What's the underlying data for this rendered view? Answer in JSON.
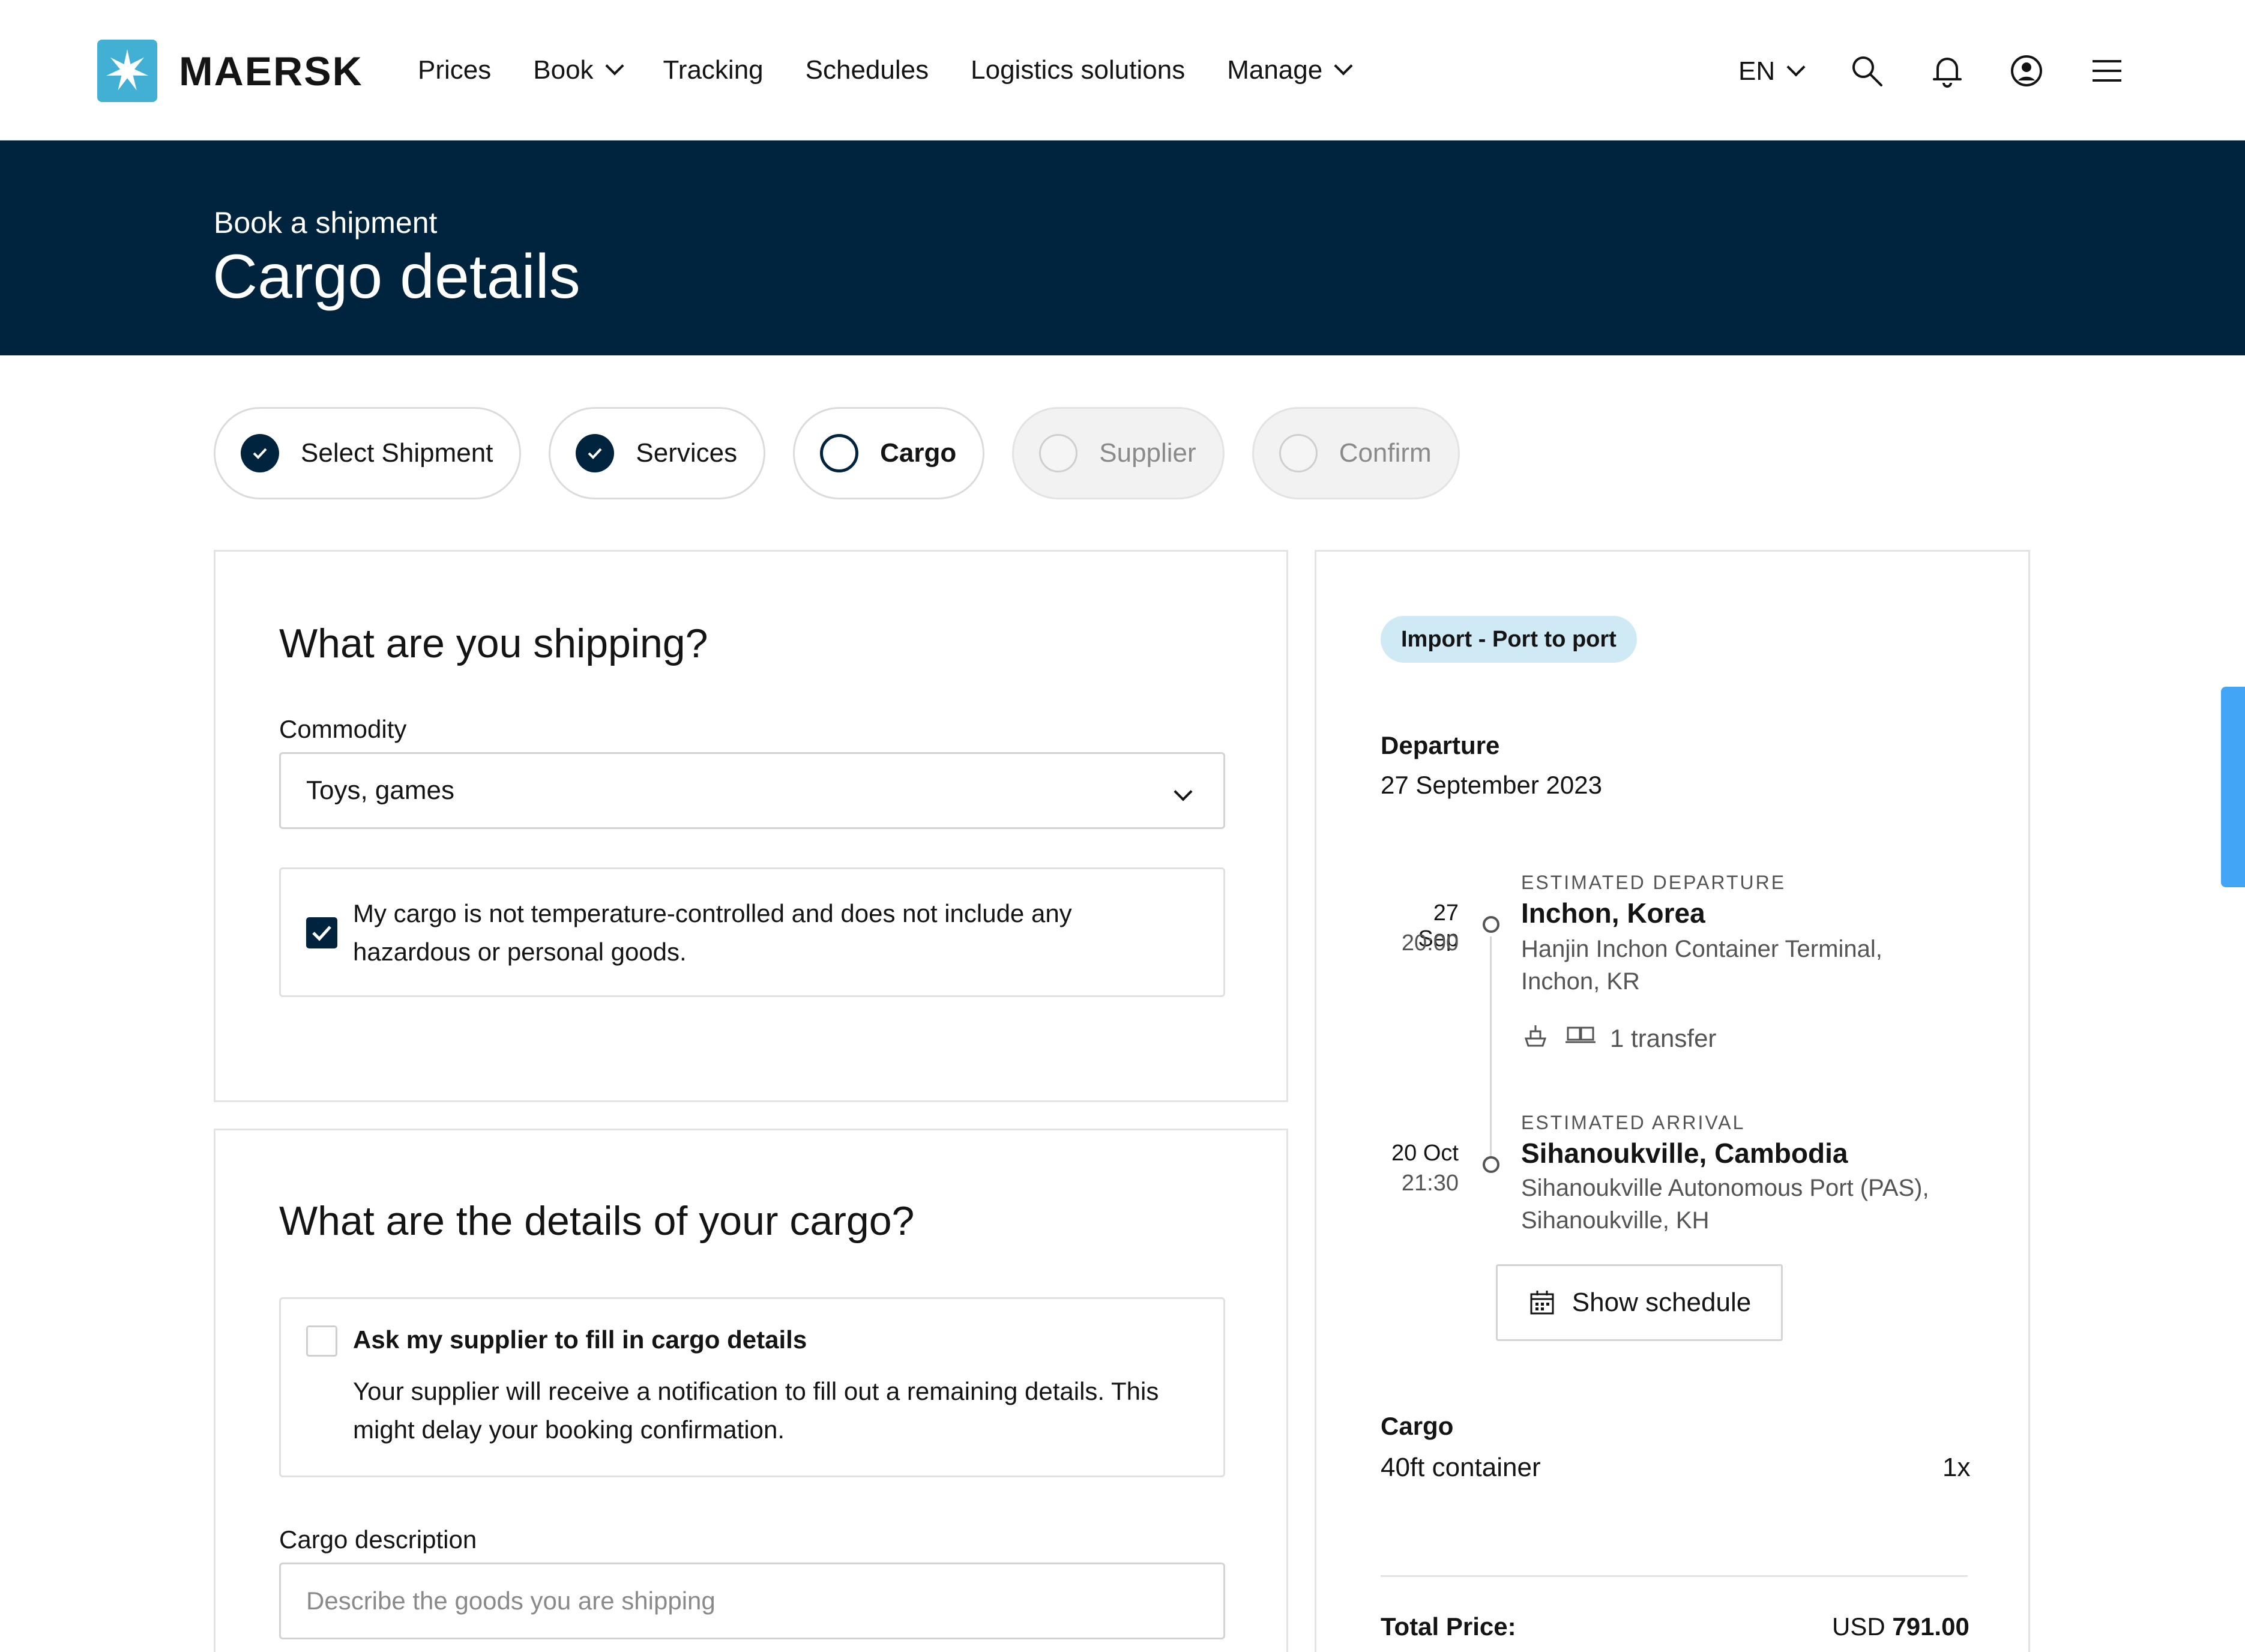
{
  "brand": {
    "name": "MAERSK"
  },
  "nav": {
    "items": [
      {
        "label": "Prices",
        "dropdown": false
      },
      {
        "label": "Book",
        "dropdown": true
      },
      {
        "label": "Tracking",
        "dropdown": false
      },
      {
        "label": "Schedules",
        "dropdown": false
      },
      {
        "label": "Logistics solutions",
        "dropdown": false
      },
      {
        "label": "Manage",
        "dropdown": true
      }
    ],
    "language": "EN",
    "icons": [
      "search-icon",
      "bell-icon",
      "user-icon",
      "menu-icon"
    ]
  },
  "hero": {
    "subtitle": "Book a shipment",
    "title": "Cargo details"
  },
  "steps": [
    {
      "label": "Select Shipment",
      "state": "done"
    },
    {
      "label": "Services",
      "state": "done"
    },
    {
      "label": "Cargo",
      "state": "active"
    },
    {
      "label": "Supplier",
      "state": "todo"
    },
    {
      "label": "Confirm",
      "state": "todo"
    }
  ],
  "shipping_card": {
    "title": "What are you shipping?",
    "commodity_label": "Commodity",
    "commodity_value": "Toys, games",
    "declaration_line1": "My cargo is not temperature-controlled and does not include any",
    "declaration_line2": "hazardous or personal goods.",
    "declaration_checked": true
  },
  "cargo_card": {
    "title": "What are the details of your cargo?",
    "supplier_option_title": "Ask my supplier to fill in cargo details",
    "supplier_option_line1": "Your supplier will receive a notification to fill out a remaining details. This",
    "supplier_option_line2": "might delay your booking confirmation.",
    "supplier_option_checked": false,
    "description_label": "Cargo description",
    "description_placeholder": "Describe the goods you are shipping"
  },
  "summary": {
    "badge": "Import - Port to port",
    "departure_heading": "Departure",
    "departure_date": "27 September 2023",
    "origin": {
      "eyebrow": "ESTIMATED DEPARTURE",
      "date": "27 Sep",
      "time": "20:00",
      "port": "Inchon, Korea",
      "terminal_line1": "Hanjin Inchon Container Terminal,",
      "terminal_line2": "Inchon, KR"
    },
    "transfer": "1 transfer",
    "destination": {
      "eyebrow": "ESTIMATED ARRIVAL",
      "date": "20 Oct",
      "time": "21:30",
      "port": "Sihanoukville, Cambodia",
      "terminal_line1": "Sihanoukville Autonomous Port (PAS),",
      "terminal_line2": "Sihanoukville, KH"
    },
    "show_schedule": "Show schedule",
    "cargo_heading": "Cargo",
    "cargo_item": "40ft container",
    "cargo_qty": "1x",
    "total_label": "Total Price:",
    "total_currency": "USD",
    "total_amount": "791.00"
  },
  "colors": {
    "navy": "#00243d",
    "brand_blue": "#42b0d5",
    "badge_bg": "#cfe9f5",
    "feedback_tab": "#42a5f5"
  }
}
